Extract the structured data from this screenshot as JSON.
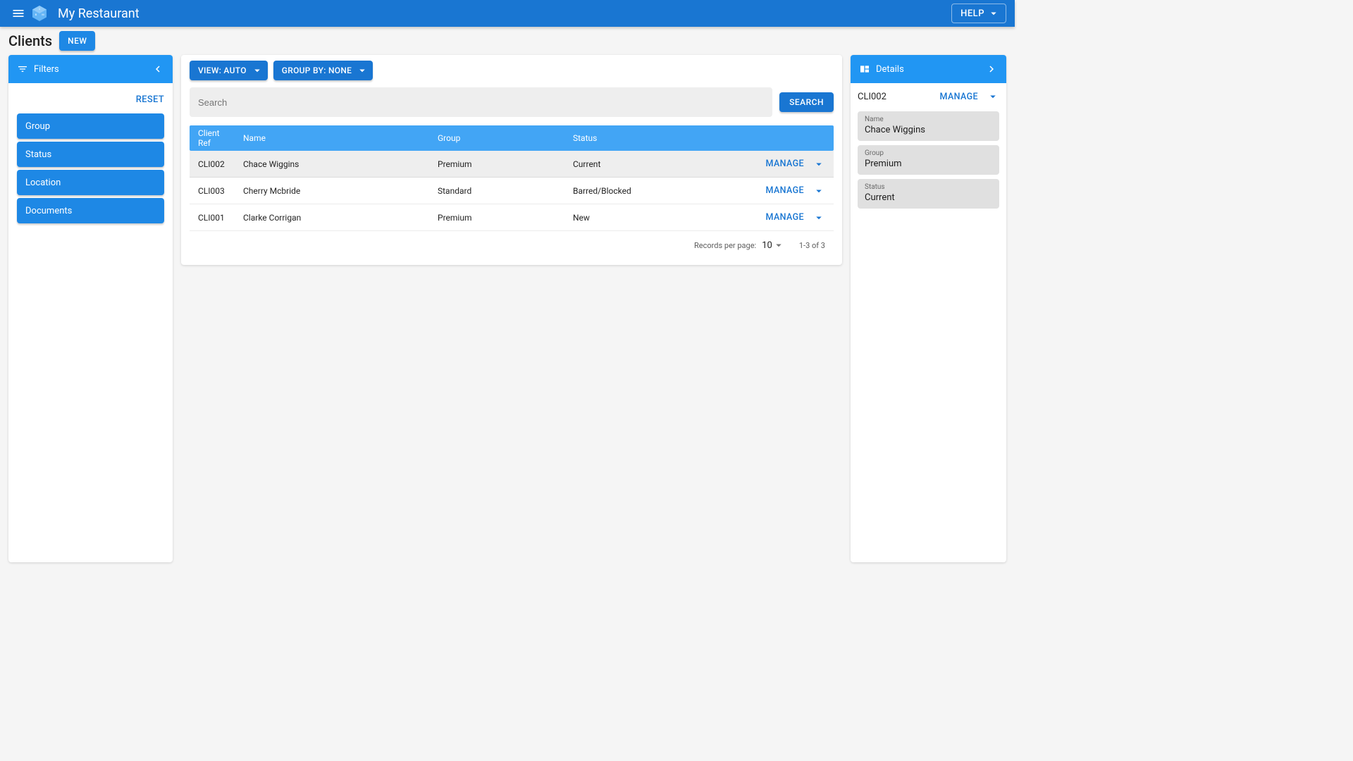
{
  "appbar": {
    "title": "My Restaurant",
    "help_label": "HELP"
  },
  "page": {
    "title": "Clients",
    "new_label": "NEW"
  },
  "filters": {
    "header": "Filters",
    "reset_label": "RESET",
    "items": [
      "Group",
      "Status",
      "Location",
      "Documents"
    ]
  },
  "toolbar": {
    "view_label": "VIEW: AUTO",
    "group_by_label": "GROUP BY: NONE"
  },
  "search": {
    "placeholder": "Search",
    "button_label": "SEARCH"
  },
  "table": {
    "columns": {
      "ref": "Client Ref",
      "name": "Name",
      "group": "Group",
      "status": "Status"
    },
    "manage_label": "MANAGE",
    "rows": [
      {
        "ref": "CLI002",
        "name": "Chace Wiggins",
        "group": "Premium",
        "status": "Current",
        "selected": true
      },
      {
        "ref": "CLI003",
        "name": "Cherry Mcbride",
        "group": "Standard",
        "status": "Barred/Blocked",
        "selected": false
      },
      {
        "ref": "CLI001",
        "name": "Clarke Corrigan",
        "group": "Premium",
        "status": "New",
        "selected": false
      }
    ],
    "footer": {
      "records_per_page_label": "Records per page:",
      "records_per_page_value": "10",
      "range": "1-3 of 3"
    }
  },
  "details": {
    "header": "Details",
    "id": "CLI002",
    "manage_label": "MANAGE",
    "fields": [
      {
        "label": "Name",
        "value": "Chace Wiggins"
      },
      {
        "label": "Group",
        "value": "Premium"
      },
      {
        "label": "Status",
        "value": "Current"
      }
    ]
  }
}
